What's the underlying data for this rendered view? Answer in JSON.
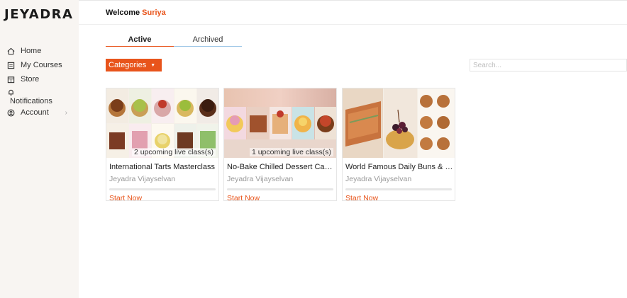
{
  "brand": {
    "logo_text": "JEYADRA"
  },
  "sidebar": {
    "items": [
      {
        "label": "Home",
        "icon": "home-icon"
      },
      {
        "label": "My Courses",
        "icon": "book-icon"
      },
      {
        "label": "Store",
        "icon": "store-icon"
      },
      {
        "label": "Notifications",
        "icon": "bell-icon"
      },
      {
        "label": "Account",
        "icon": "user-icon"
      }
    ]
  },
  "header": {
    "welcome_label": "Welcome",
    "user_name": "Suriya"
  },
  "tabs": [
    {
      "label": "Active",
      "selected": true
    },
    {
      "label": "Archived",
      "selected": false
    }
  ],
  "filters": {
    "categories_label": "Categories",
    "search_placeholder": "Search..."
  },
  "courses": [
    {
      "title": "International Tarts Masterclass",
      "author": "Jeyadra Vijayselvan",
      "live": "2 upcoming live class(s)",
      "cta": "Start Now",
      "progress": 0
    },
    {
      "title": "No-Bake Chilled Dessert Cakes",
      "author": "Jeyadra Vijayselvan",
      "live": "1 upcoming live class(s)",
      "cta": "Start Now",
      "progress": 0
    },
    {
      "title": "World Famous Daily Buns & Breads",
      "author": "Jeyadra Vijayselvan",
      "live": "",
      "cta": "Start Now",
      "progress": 0
    }
  ],
  "colors": {
    "accent": "#e8541b",
    "sidebar_bg": "#f8f5f2"
  }
}
